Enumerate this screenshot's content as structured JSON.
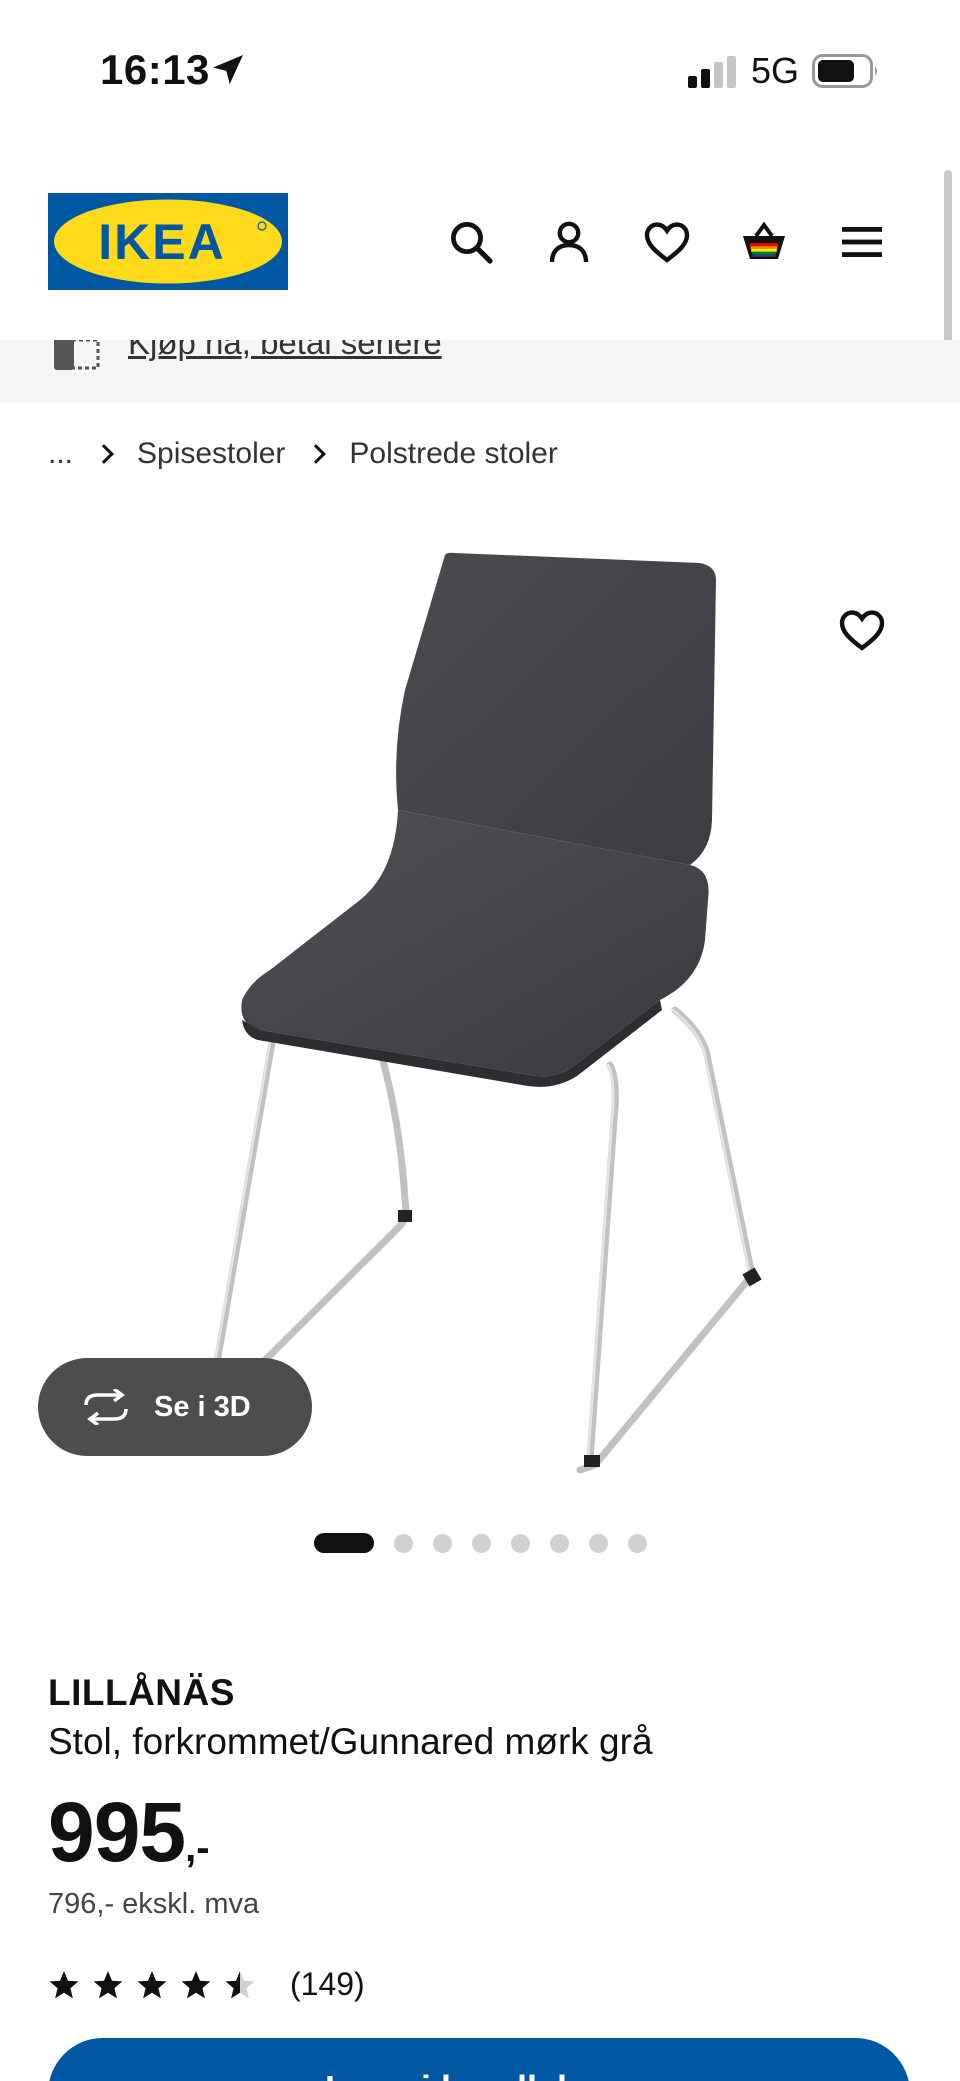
{
  "status_bar": {
    "time": "16:13",
    "network": "5G"
  },
  "header": {
    "logo_text": "IKEA",
    "brand_colors": {
      "blue": "#0058a3",
      "yellow": "#ffda1a"
    },
    "icons": [
      "search-icon",
      "user-icon",
      "heart-icon",
      "cart-icon",
      "menu-icon"
    ]
  },
  "promo": {
    "link_text": "Kjøp nå, betal senere"
  },
  "breadcrumb": {
    "ellipsis": "...",
    "items": [
      "Spisestoler",
      "Polstrede stoler"
    ]
  },
  "gallery": {
    "view_3d_label": "Se i 3D",
    "total_images": 8,
    "active_index": 0
  },
  "product": {
    "name": "LILLÅNÄS",
    "description": "Stol, forkrommet/Gunnared mørk grå",
    "price": "995",
    "price_suffix": ",-",
    "price_excl_vat": "796,- ekskl. mva",
    "rating": 4.5,
    "rating_max": 5,
    "review_count": "(149)"
  },
  "cta": {
    "label": "Legg i handlekurv"
  }
}
